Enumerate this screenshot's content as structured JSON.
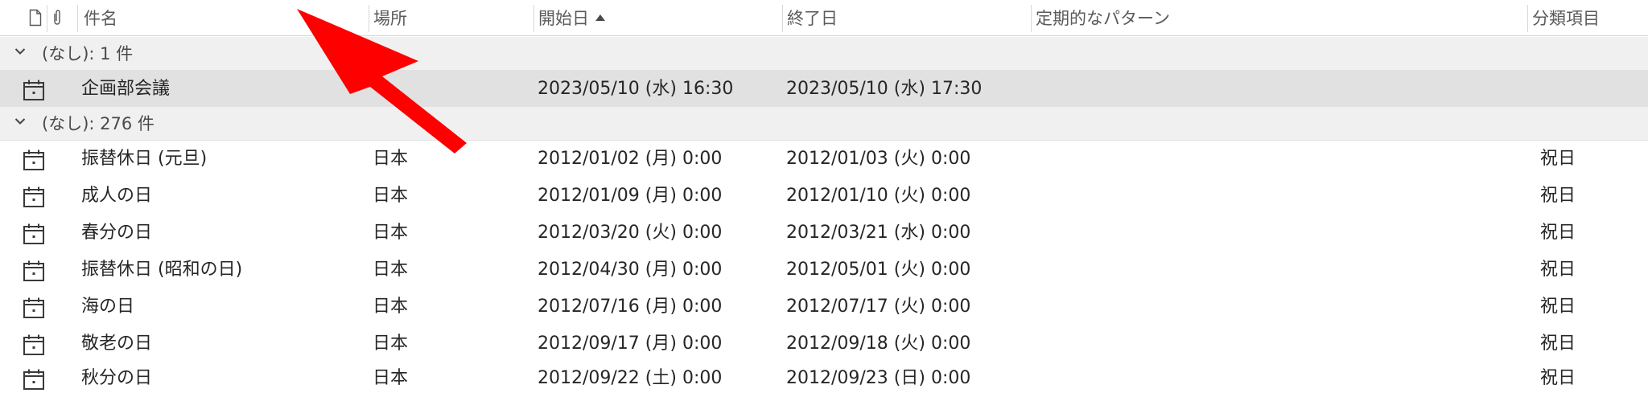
{
  "header": {
    "columns": {
      "subject": "件名",
      "location": "場所",
      "start": "開始日",
      "end": "終了日",
      "recurrence": "定期的なパターン",
      "category": "分類項目"
    }
  },
  "groups": [
    {
      "label": "(なし): 1 件",
      "items": [
        {
          "subject": "企画部会議",
          "location": "",
          "start": "2023/05/10 (水) 16:30",
          "end": "2023/05/10 (水) 17:30",
          "recurrence": "",
          "category": "",
          "selected": true
        }
      ]
    },
    {
      "label": "(なし): 276 件",
      "items": [
        {
          "subject": "振替休日 (元旦)",
          "location": "日本",
          "start": "2012/01/02 (月) 0:00",
          "end": "2012/01/03 (火) 0:00",
          "recurrence": "",
          "category": "祝日"
        },
        {
          "subject": "成人の日",
          "location": "日本",
          "start": "2012/01/09 (月) 0:00",
          "end": "2012/01/10 (火) 0:00",
          "recurrence": "",
          "category": "祝日"
        },
        {
          "subject": "春分の日",
          "location": "日本",
          "start": "2012/03/20 (火) 0:00",
          "end": "2012/03/21 (水) 0:00",
          "recurrence": "",
          "category": "祝日"
        },
        {
          "subject": "振替休日 (昭和の日)",
          "location": "日本",
          "start": "2012/04/30 (月) 0:00",
          "end": "2012/05/01 (火) 0:00",
          "recurrence": "",
          "category": "祝日"
        },
        {
          "subject": "海の日",
          "location": "日本",
          "start": "2012/07/16 (月) 0:00",
          "end": "2012/07/17 (火) 0:00",
          "recurrence": "",
          "category": "祝日"
        },
        {
          "subject": "敬老の日",
          "location": "日本",
          "start": "2012/09/17 (月) 0:00",
          "end": "2012/09/18 (火) 0:00",
          "recurrence": "",
          "category": "祝日"
        },
        {
          "subject": "秋分の日",
          "location": "日本",
          "start": "2012/09/22 (土) 0:00",
          "end": "2012/09/23 (日) 0:00",
          "recurrence": "",
          "category": "祝日"
        }
      ]
    }
  ],
  "icons": {
    "header_item_type": "document-icon",
    "header_attachment": "paperclip-icon",
    "group_toggle": "chevron-down-icon",
    "row_type": "calendar-icon",
    "annotation": "red-arrow-pointer"
  },
  "colors": {
    "selected_row": "#e1e1e1",
    "group_row": "#f0f0f0",
    "annotation_arrow": "#ff0000"
  }
}
